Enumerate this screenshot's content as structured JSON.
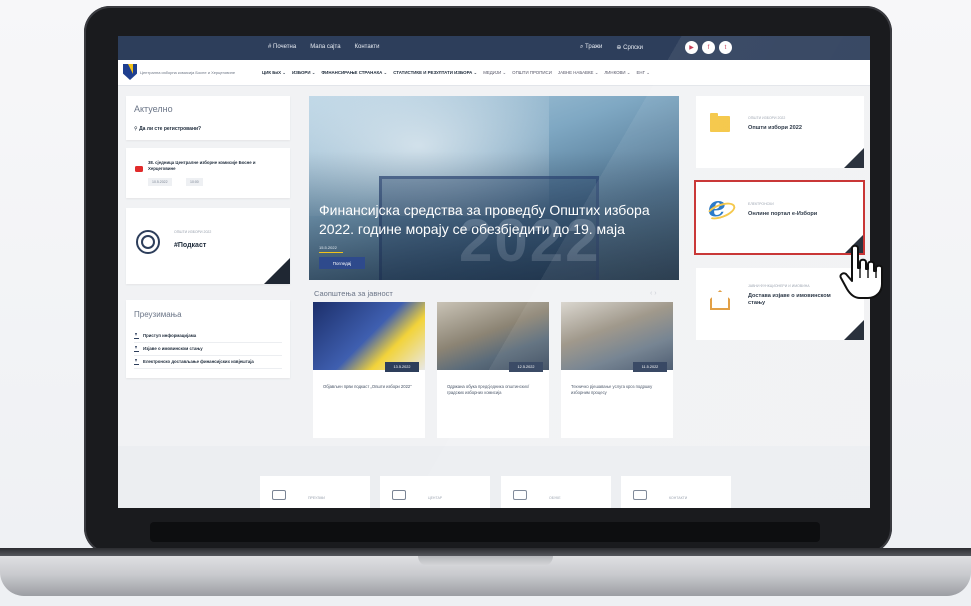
{
  "topbar": {
    "links": [
      "# Почетна",
      "Мапа сајта",
      "Контакти"
    ],
    "search_label": "Тражи",
    "lang_label": "Српски"
  },
  "nav": {
    "org_name": "Централна изборна комисија Босне и Херцеговине",
    "menu": [
      "ЦИК БиХ ⌄",
      "ИЗБОРИ ⌄",
      "ФИНАНСИРАЊЕ СТРАНАКА ⌄",
      "СТАТИСТИКЕ И РЕЗУЛТАТИ ИЗБОРА ⌄",
      "МЕДИЈИ ⌄",
      "ОПШТИ ПРОПИСИ",
      "ЈАВНЕ НАБАВКЕ ⌄",
      "ЛИНКОВИ ⌄",
      "ЕНГ ⌄"
    ]
  },
  "aktuelno": {
    "title": "Актуелно",
    "question": "Да ли сте регистровани?"
  },
  "youtube": {
    "text": "38. сједница Централне изборне комисије Босне и Херцеговине",
    "date": "10.5.2022",
    "time": "10:00"
  },
  "podcast": {
    "caption": "ОПШТИ ИЗБОРИ 2022",
    "title": "#Подкаст"
  },
  "downloads": {
    "title": "Преузимања",
    "items": [
      "Приступ информацијама",
      "Изјаве о имовинском стању",
      "Електронско достављање финансијских извјештаја"
    ]
  },
  "hero": {
    "title": "Финансијска средства за проведбу Општих избора 2022. године морају се обезбједити до 19. маја",
    "date": "15.5.2022",
    "button": "Погледај",
    "bg_year": "2022"
  },
  "news": {
    "title": "Саопштења за јавност",
    "arrows": "‹ ›",
    "items": [
      {
        "date": "13.5.2022",
        "caption": "Објављен први подкаст „Општи избори 2022“"
      },
      {
        "date": "12.5.2022",
        "caption": "Одржана обука предсједника општинских/градских изборних комисија"
      },
      {
        "date": "11.5.2022",
        "caption": "Техничко рјешавање услуга кроз подршку изборним процесу"
      }
    ]
  },
  "right": [
    {
      "caption": "ОПШТИ ИЗБОРИ 2022",
      "title": "Општи избори 2022",
      "icon": "folder-icon"
    },
    {
      "caption": "ЕЛЕКТРОНСКИ",
      "title": "Онлине портал е-Избори",
      "icon": "internet-explorer-icon"
    },
    {
      "caption": "ЈАВНИ ФУНКЦИОНЕРИ И ИМОВИНА",
      "title": "Достава изјаве о имовинском стању",
      "icon": "house-icon"
    }
  ],
  "footer_boxes": [
    "ПРЕУЗМИ",
    "ЦЕНТАР",
    "ОБУКЕ",
    "КОНТАКТИ"
  ],
  "colors": {
    "navy": "#2d3e5b",
    "highlight": "#c62b2b",
    "accent": "#f2c21a"
  }
}
